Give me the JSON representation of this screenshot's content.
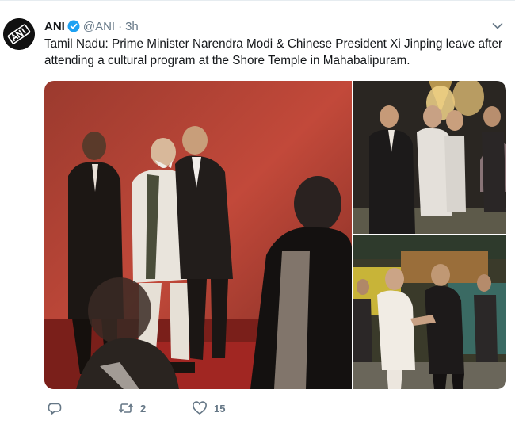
{
  "tweet": {
    "avatar_label": "ANI",
    "author_name": "ANI",
    "handle": "@ANI",
    "separator": "·",
    "time": "3h",
    "text": "Tamil Nadu: Prime Minister Narendra Modi & Chinese President Xi Jinping leave after attending a cultural program at the Shore Temple in Mahabalipuram.",
    "verified": true
  },
  "media": {
    "photos": [
      {
        "name": "main-photo",
        "scene": "leaders-walking-red-stage"
      },
      {
        "name": "top-right-photo",
        "scene": "group-walking-temple-lights"
      },
      {
        "name": "bottom-right-photo",
        "scene": "handshake-near-flowers"
      }
    ]
  },
  "actions": {
    "reply_icon": "reply-icon",
    "retweet_icon": "retweet-icon",
    "retweet_count": "2",
    "like_icon": "heart-icon",
    "like_count": "15"
  },
  "colors": {
    "text_primary": "#14171a",
    "text_secondary": "#657786",
    "verified_blue": "#1da1f2",
    "border": "#e6ecf0"
  }
}
